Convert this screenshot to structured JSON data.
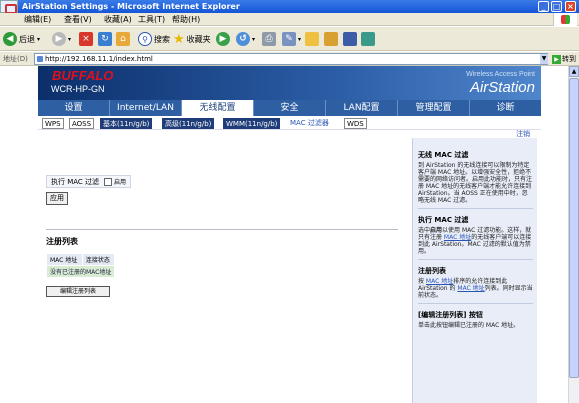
{
  "window": {
    "title": "AirStation Settings - Microsoft Internet Explorer",
    "controls": {
      "minimize": "_",
      "maximize": "□",
      "close": "×"
    }
  },
  "menubar": {
    "items": [
      "编辑(E)",
      "查看(V)",
      "收藏(A)",
      "工具(T)",
      "帮助(H)"
    ]
  },
  "toolbar": {
    "back_label": "后退",
    "search_label": "搜索",
    "favorites_label": "收藏夹"
  },
  "addressbar": {
    "label": "地址(D)",
    "url": "http://192.168.11.1/index.html",
    "go_label": "转到"
  },
  "header": {
    "logo": "BUFFALO",
    "model": "WCR-HP-GN",
    "tagline": "Wireless Access Point",
    "brand": "AirStation"
  },
  "nav": {
    "tabs": [
      "设置",
      "Internet/LAN",
      "无线配置",
      "安全",
      "LAN配置",
      "管理配置",
      "诊断"
    ],
    "active": "无线配置"
  },
  "subnav": {
    "items": [
      {
        "label": "WPS",
        "style": "plain"
      },
      {
        "label": "AOSS",
        "style": "plain"
      },
      {
        "label": "基本(11n/g/b)",
        "style": "dark"
      },
      {
        "label": "高级(11n/g/b)",
        "style": "dark"
      },
      {
        "label": "WMM(11n/g/b)",
        "style": "dark"
      },
      {
        "label": "MAC 过滤器",
        "style": "active"
      },
      {
        "label": "WDS",
        "style": "plain"
      }
    ]
  },
  "logout_label": "注销",
  "main": {
    "enable_label": "执行 MAC 过滤",
    "enable_checkbox_label": "启用",
    "apply_button": "应用",
    "reglist_title": "注册列表",
    "table": {
      "headers": [
        "MAC 地址",
        "连接状态"
      ],
      "empty_message": "没有已注册的MAC地址"
    },
    "edit_button": "编辑注册列表"
  },
  "help": {
    "title": "无线 MAC 过滤",
    "intro": "到 AirStation 的无线连接可以限制为特定客户端 MAC 地址。以增强安全性，拒绝不需要的网络访问者。启用此功能时，只有注册 MAC 地址的无线客户端才能允许连接到 AirStation。当 AOSS 正在使用中时，忽略无线 MAC 过滤。",
    "enable_title": "执行 MAC 过滤",
    "enable_pre": "选中",
    "enable_bold": "启用",
    "enable_mid": "以使用 MAC 过滤功能。这样，就只有注册 ",
    "enable_link": "MAC 地址",
    "enable_post": "的无线客户端可以连接到此 AirStation。MAC 过滤的默认值为禁用。",
    "reglist_title": "注册列表",
    "reglist_pre": "按 ",
    "reglist_link1": "MAC 地址",
    "reglist_mid": "排序的允许连接到此 AirStation 的 ",
    "reglist_link2": "MAC 地址",
    "reglist_post": "列表。同时显示当前状态。",
    "edit_title": "[编辑注册列表] 按钮",
    "edit_text": "单击此按钮编辑已注册的 MAC 地址。"
  }
}
